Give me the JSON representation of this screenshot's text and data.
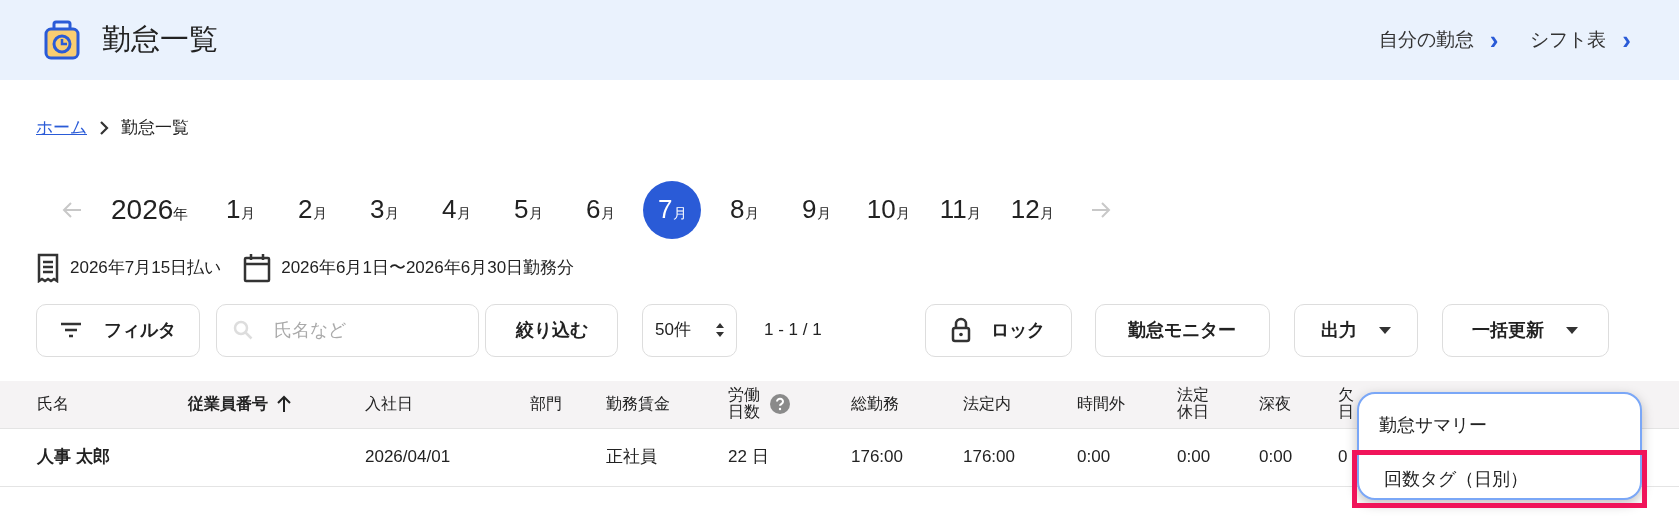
{
  "header": {
    "title": "勤怠一覧",
    "links": [
      {
        "label": "自分の勤怠",
        "chevron": "›"
      },
      {
        "label": "シフト表",
        "chevron": "›"
      }
    ]
  },
  "breadcrumb": {
    "items": [
      {
        "label": "ホーム",
        "kind": "link"
      },
      {
        "label": "勤怠一覧",
        "kind": "current"
      }
    ]
  },
  "month_picker": {
    "prev_disabled": true,
    "next_disabled": true,
    "year": "2026",
    "year_suffix": "年",
    "months": [
      {
        "number": "1",
        "suffix": "月",
        "selected": false
      },
      {
        "number": "2",
        "suffix": "月",
        "selected": false
      },
      {
        "number": "3",
        "suffix": "月",
        "selected": false
      },
      {
        "number": "4",
        "suffix": "月",
        "selected": false
      },
      {
        "number": "5",
        "suffix": "月",
        "selected": false
      },
      {
        "number": "6",
        "suffix": "月",
        "selected": false
      },
      {
        "number": "7",
        "suffix": "月",
        "selected": true
      },
      {
        "number": "8",
        "suffix": "月",
        "selected": false
      },
      {
        "number": "9",
        "suffix": "月",
        "selected": false
      },
      {
        "number": "10",
        "suffix": "月",
        "selected": false
      },
      {
        "number": "11",
        "suffix": "月",
        "selected": false
      },
      {
        "number": "12",
        "suffix": "月",
        "selected": false
      }
    ]
  },
  "period": {
    "payday": "2026年7月15日払い",
    "range": "2026年6月1日〜2026年6月30日勤務分"
  },
  "toolbar": {
    "filter": "フィルタ",
    "search_placeholder": "氏名など",
    "narrow": "絞り込む",
    "per_page": "50件",
    "pagination": "1 - 1 / 1",
    "lock": "ロック",
    "monitor": "勤怠モニター",
    "export": "出力",
    "bulk": "一括更新"
  },
  "table": {
    "columns": [
      {
        "label": "氏名",
        "sorted": false,
        "help": false
      },
      {
        "label": "従業員番号",
        "sorted": true,
        "help": false
      },
      {
        "label": "入社日",
        "sorted": false,
        "help": false
      },
      {
        "label": "部門",
        "sorted": false,
        "help": false
      },
      {
        "label": "勤務賃金",
        "sorted": false,
        "help": false
      },
      {
        "label": "労働日数",
        "sorted": false,
        "help": true
      },
      {
        "label": "総勤務",
        "sorted": false,
        "help": false
      },
      {
        "label": "法定内",
        "sorted": false,
        "help": false
      },
      {
        "label": "時間外",
        "sorted": false,
        "help": false
      },
      {
        "label": "法定休日",
        "sorted": false,
        "help": false
      },
      {
        "label": "深夜",
        "sorted": false,
        "help": false
      },
      {
        "label": "欠日",
        "sorted": false
      }
    ],
    "rows": [
      {
        "cells": [
          "人事 太郎",
          "",
          "2026/04/01",
          "",
          "正社員",
          "22 日",
          "176:00",
          "176:00",
          "0:00",
          "0:00",
          "0:00",
          "0"
        ]
      }
    ]
  },
  "menu": {
    "items": [
      {
        "label": "勤怠サマリー",
        "highlighted": false
      },
      {
        "label": "回数タグ（日別）",
        "highlighted": true
      }
    ]
  }
}
